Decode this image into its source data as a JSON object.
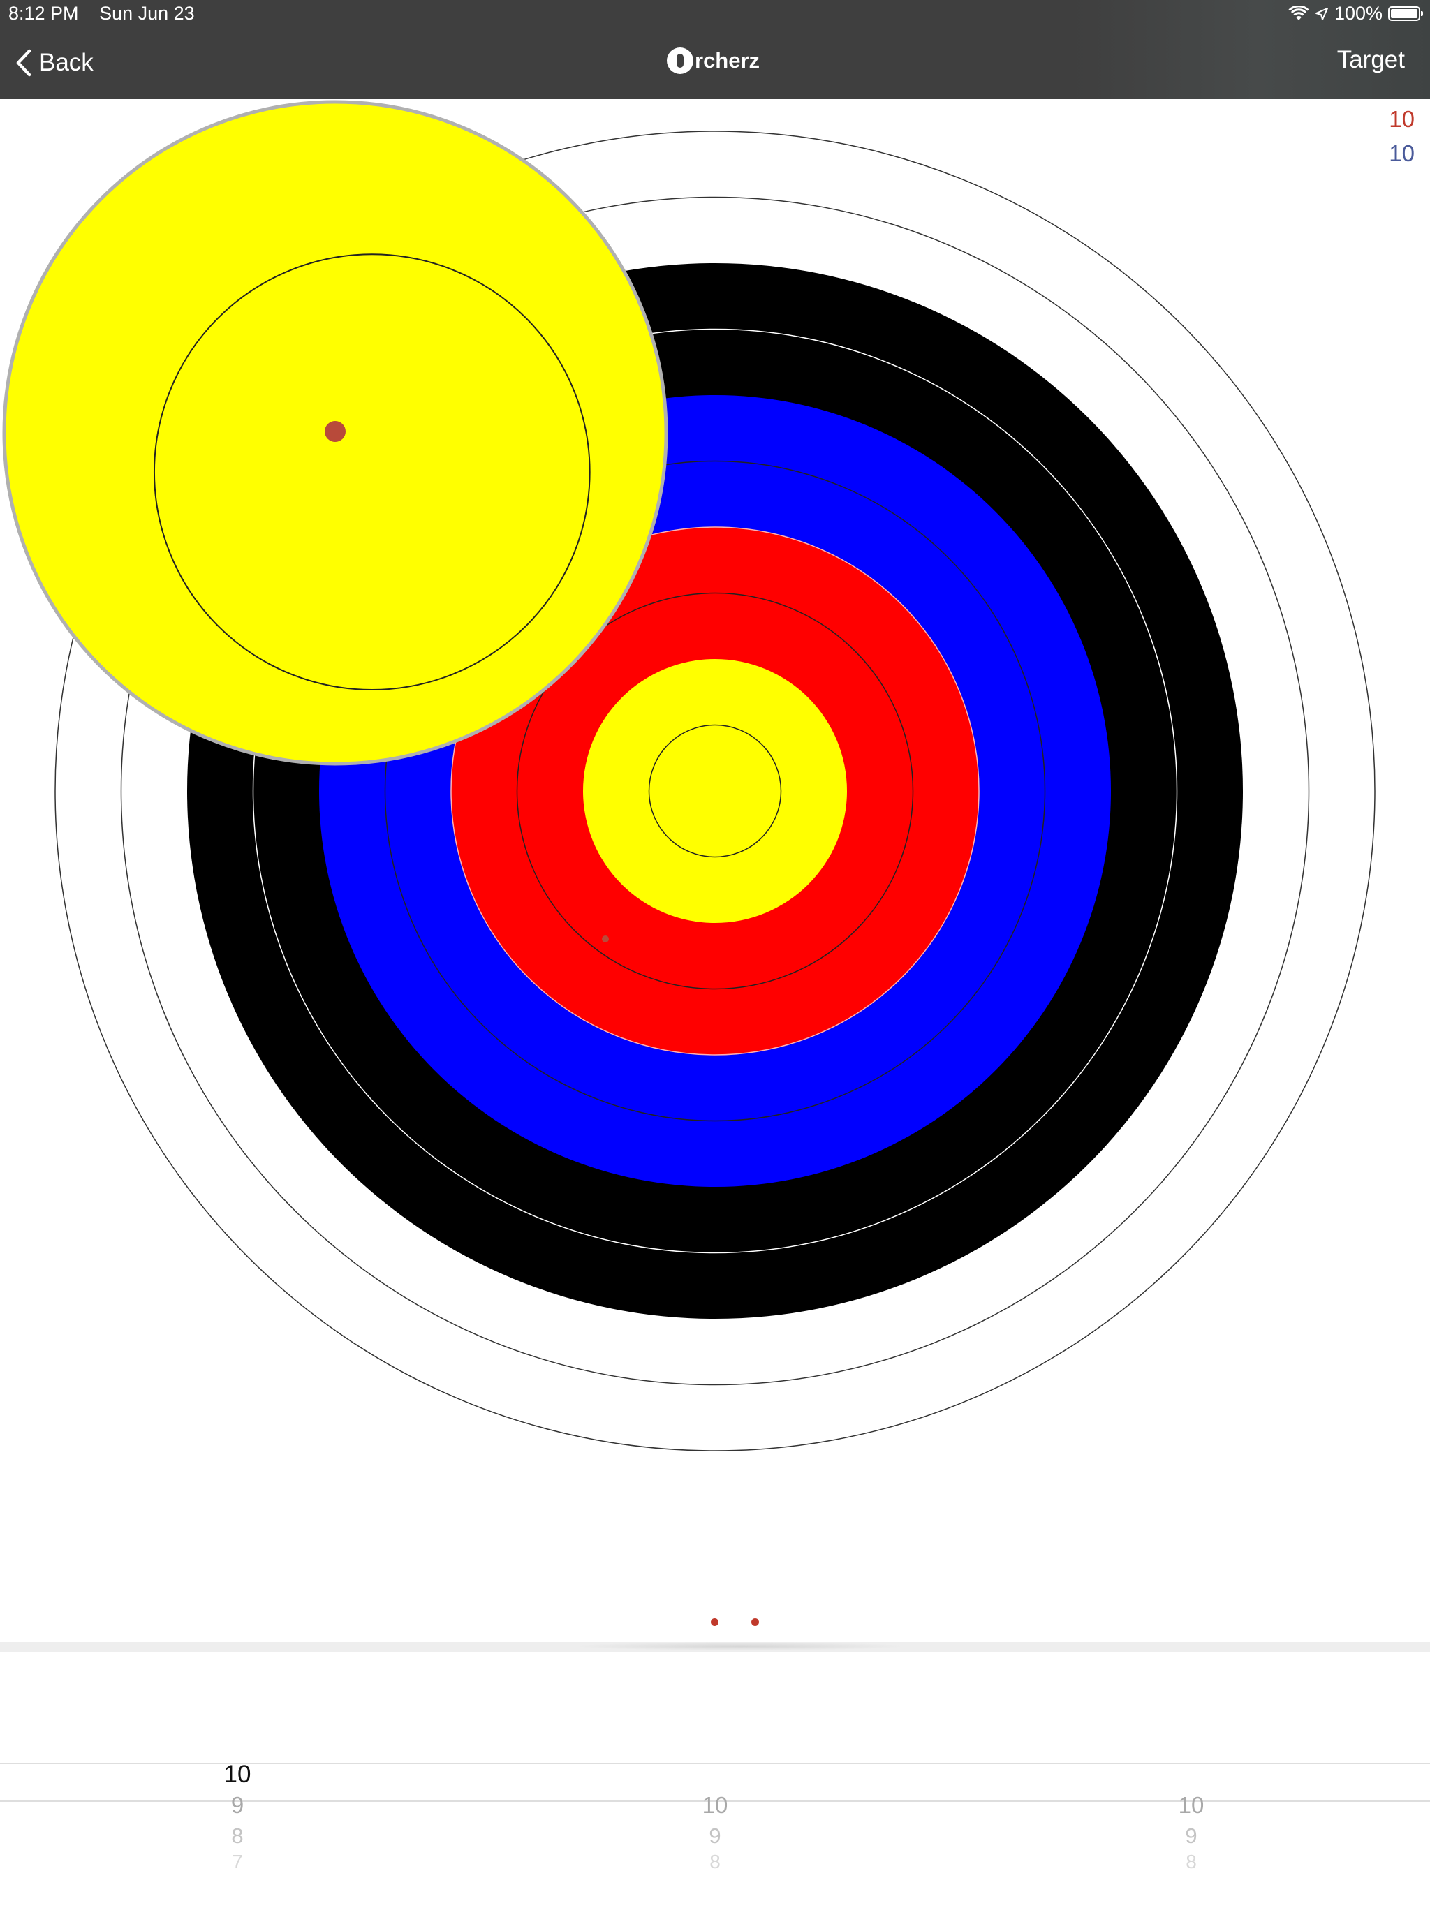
{
  "status_bar": {
    "time": "8:12 PM",
    "date": "Sun Jun 23",
    "battery": "100%",
    "icons": [
      "wifi-icon",
      "location-icon",
      "battery-icon"
    ]
  },
  "nav": {
    "back_label": "Back",
    "logo_text": "rcherz",
    "right_label": "Target"
  },
  "scores": {
    "red": "10",
    "blue": "10"
  },
  "target": {
    "ring_colors": [
      "#ffffff",
      "#ffffff",
      "#000000",
      "#000000",
      "#0000ff",
      "#0000ff",
      "#ff0000",
      "#ff0000",
      "#ffff00",
      "#ffff00"
    ],
    "arrows_shown": 1,
    "magnifier": "visible"
  },
  "pager": {
    "pages": 2,
    "active_color": "#c0392b"
  },
  "picker": {
    "columns": [
      {
        "selected": "10",
        "below": [
          "9",
          "8",
          "7"
        ]
      },
      {
        "selected": "",
        "below": [
          "10",
          "9",
          "8"
        ]
      },
      {
        "selected": "",
        "below": [
          "10",
          "9",
          "8"
        ]
      }
    ]
  },
  "colors": {
    "nav_background": "#3f3f3f",
    "score_red": "#c0392b",
    "score_blue": "#4a5a9a"
  }
}
